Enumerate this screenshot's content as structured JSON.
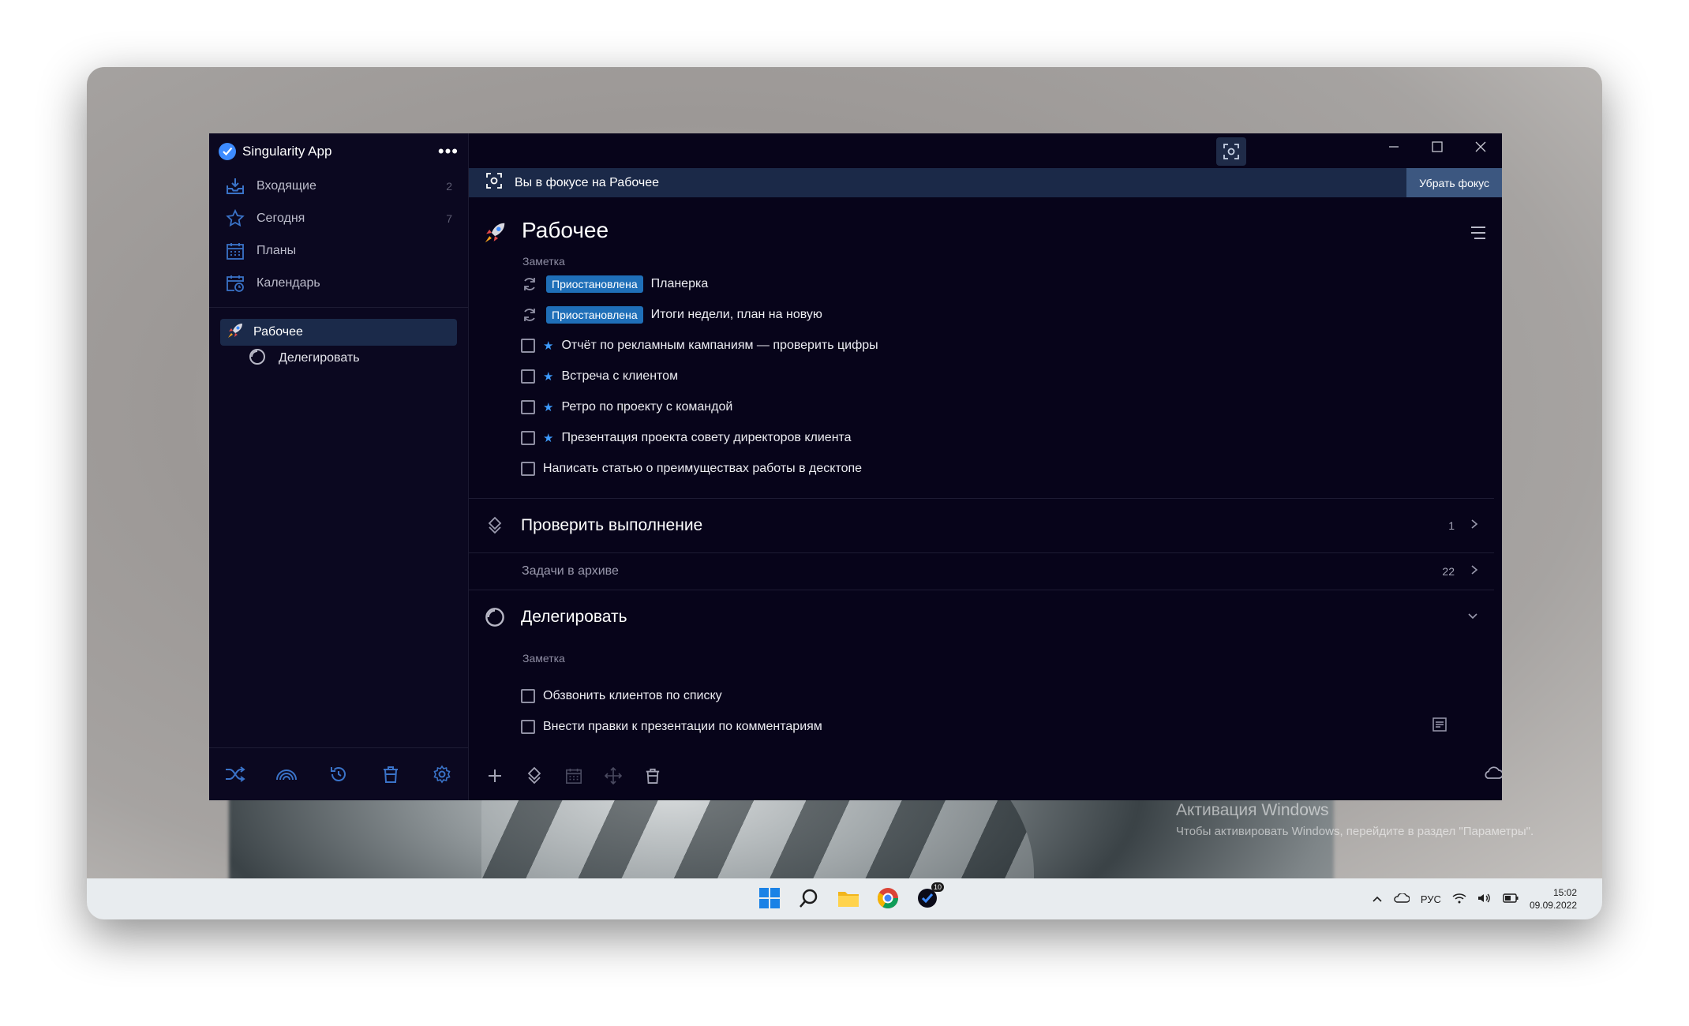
{
  "app": {
    "title": "Singularity App"
  },
  "sidebar": {
    "items": [
      {
        "label": "Входящие",
        "count": "2"
      },
      {
        "label": "Сегодня",
        "count": "7"
      },
      {
        "label": "Планы",
        "count": ""
      },
      {
        "label": "Календарь",
        "count": ""
      }
    ],
    "projects": [
      {
        "label": "Рабочее"
      },
      {
        "label": "Делегировать"
      }
    ]
  },
  "focus": {
    "text": "Вы в фокусе на Рабочее",
    "button": "Убрать фокус"
  },
  "project": {
    "title": "Рабочее",
    "note": "Заметка",
    "tasks": [
      {
        "status": "Приостановлена",
        "text": "Планерка"
      },
      {
        "status": "Приостановлена",
        "text": "Итоги недели, план на новую"
      },
      {
        "text": "Отчёт по рекламным кампаниям — проверить цифры",
        "star": "★"
      },
      {
        "text": "Встреча с клиентом",
        "star": "★"
      },
      {
        "text": "Ретро по проекту с командой",
        "star": "★"
      },
      {
        "text": "Презентация проекта совету директоров клиента",
        "star": "★"
      },
      {
        "text": "Написать статью о преимуществах работы в десктопе"
      }
    ]
  },
  "sections": {
    "check": {
      "title": "Проверить выполнение",
      "count": "1"
    },
    "archive": {
      "title": "Задачи в архиве",
      "count": "22"
    },
    "delegate": {
      "title": "Делегировать",
      "note": "Заметка",
      "tasks": [
        {
          "text": "Обзвонить клиентов по списку"
        },
        {
          "text": "Внести правки к презентации по комментариям"
        }
      ]
    }
  },
  "taskbar": {
    "lang": "РУС",
    "time": "15:02",
    "date": "09.09.2022",
    "badge": "10"
  },
  "watermark": {
    "title": "Активация Windows",
    "text": "Чтобы активировать Windows, перейдите в раздел \"Параметры\"."
  },
  "colors": {
    "accent": "#3d8bff",
    "status": "#1f6fb8",
    "background": "#07041a",
    "sidebar": "#0b0820",
    "focus_bar": "#1b2948"
  }
}
